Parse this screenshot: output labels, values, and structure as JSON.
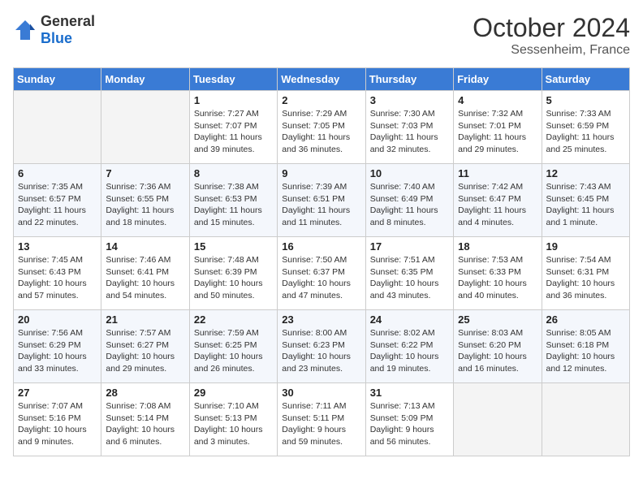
{
  "header": {
    "logo_general": "General",
    "logo_blue": "Blue",
    "month": "October 2024",
    "location": "Sessenheim, France"
  },
  "columns": [
    "Sunday",
    "Monday",
    "Tuesday",
    "Wednesday",
    "Thursday",
    "Friday",
    "Saturday"
  ],
  "weeks": [
    [
      {
        "day": "",
        "empty": true
      },
      {
        "day": "",
        "empty": true
      },
      {
        "day": "1",
        "sunrise": "Sunrise: 7:27 AM",
        "sunset": "Sunset: 7:07 PM",
        "daylight": "Daylight: 11 hours and 39 minutes."
      },
      {
        "day": "2",
        "sunrise": "Sunrise: 7:29 AM",
        "sunset": "Sunset: 7:05 PM",
        "daylight": "Daylight: 11 hours and 36 minutes."
      },
      {
        "day": "3",
        "sunrise": "Sunrise: 7:30 AM",
        "sunset": "Sunset: 7:03 PM",
        "daylight": "Daylight: 11 hours and 32 minutes."
      },
      {
        "day": "4",
        "sunrise": "Sunrise: 7:32 AM",
        "sunset": "Sunset: 7:01 PM",
        "daylight": "Daylight: 11 hours and 29 minutes."
      },
      {
        "day": "5",
        "sunrise": "Sunrise: 7:33 AM",
        "sunset": "Sunset: 6:59 PM",
        "daylight": "Daylight: 11 hours and 25 minutes."
      }
    ],
    [
      {
        "day": "6",
        "sunrise": "Sunrise: 7:35 AM",
        "sunset": "Sunset: 6:57 PM",
        "daylight": "Daylight: 11 hours and 22 minutes."
      },
      {
        "day": "7",
        "sunrise": "Sunrise: 7:36 AM",
        "sunset": "Sunset: 6:55 PM",
        "daylight": "Daylight: 11 hours and 18 minutes."
      },
      {
        "day": "8",
        "sunrise": "Sunrise: 7:38 AM",
        "sunset": "Sunset: 6:53 PM",
        "daylight": "Daylight: 11 hours and 15 minutes."
      },
      {
        "day": "9",
        "sunrise": "Sunrise: 7:39 AM",
        "sunset": "Sunset: 6:51 PM",
        "daylight": "Daylight: 11 hours and 11 minutes."
      },
      {
        "day": "10",
        "sunrise": "Sunrise: 7:40 AM",
        "sunset": "Sunset: 6:49 PM",
        "daylight": "Daylight: 11 hours and 8 minutes."
      },
      {
        "day": "11",
        "sunrise": "Sunrise: 7:42 AM",
        "sunset": "Sunset: 6:47 PM",
        "daylight": "Daylight: 11 hours and 4 minutes."
      },
      {
        "day": "12",
        "sunrise": "Sunrise: 7:43 AM",
        "sunset": "Sunset: 6:45 PM",
        "daylight": "Daylight: 11 hours and 1 minute."
      }
    ],
    [
      {
        "day": "13",
        "sunrise": "Sunrise: 7:45 AM",
        "sunset": "Sunset: 6:43 PM",
        "daylight": "Daylight: 10 hours and 57 minutes."
      },
      {
        "day": "14",
        "sunrise": "Sunrise: 7:46 AM",
        "sunset": "Sunset: 6:41 PM",
        "daylight": "Daylight: 10 hours and 54 minutes."
      },
      {
        "day": "15",
        "sunrise": "Sunrise: 7:48 AM",
        "sunset": "Sunset: 6:39 PM",
        "daylight": "Daylight: 10 hours and 50 minutes."
      },
      {
        "day": "16",
        "sunrise": "Sunrise: 7:50 AM",
        "sunset": "Sunset: 6:37 PM",
        "daylight": "Daylight: 10 hours and 47 minutes."
      },
      {
        "day": "17",
        "sunrise": "Sunrise: 7:51 AM",
        "sunset": "Sunset: 6:35 PM",
        "daylight": "Daylight: 10 hours and 43 minutes."
      },
      {
        "day": "18",
        "sunrise": "Sunrise: 7:53 AM",
        "sunset": "Sunset: 6:33 PM",
        "daylight": "Daylight: 10 hours and 40 minutes."
      },
      {
        "day": "19",
        "sunrise": "Sunrise: 7:54 AM",
        "sunset": "Sunset: 6:31 PM",
        "daylight": "Daylight: 10 hours and 36 minutes."
      }
    ],
    [
      {
        "day": "20",
        "sunrise": "Sunrise: 7:56 AM",
        "sunset": "Sunset: 6:29 PM",
        "daylight": "Daylight: 10 hours and 33 minutes."
      },
      {
        "day": "21",
        "sunrise": "Sunrise: 7:57 AM",
        "sunset": "Sunset: 6:27 PM",
        "daylight": "Daylight: 10 hours and 29 minutes."
      },
      {
        "day": "22",
        "sunrise": "Sunrise: 7:59 AM",
        "sunset": "Sunset: 6:25 PM",
        "daylight": "Daylight: 10 hours and 26 minutes."
      },
      {
        "day": "23",
        "sunrise": "Sunrise: 8:00 AM",
        "sunset": "Sunset: 6:23 PM",
        "daylight": "Daylight: 10 hours and 23 minutes."
      },
      {
        "day": "24",
        "sunrise": "Sunrise: 8:02 AM",
        "sunset": "Sunset: 6:22 PM",
        "daylight": "Daylight: 10 hours and 19 minutes."
      },
      {
        "day": "25",
        "sunrise": "Sunrise: 8:03 AM",
        "sunset": "Sunset: 6:20 PM",
        "daylight": "Daylight: 10 hours and 16 minutes."
      },
      {
        "day": "26",
        "sunrise": "Sunrise: 8:05 AM",
        "sunset": "Sunset: 6:18 PM",
        "daylight": "Daylight: 10 hours and 12 minutes."
      }
    ],
    [
      {
        "day": "27",
        "sunrise": "Sunrise: 7:07 AM",
        "sunset": "Sunset: 5:16 PM",
        "daylight": "Daylight: 10 hours and 9 minutes."
      },
      {
        "day": "28",
        "sunrise": "Sunrise: 7:08 AM",
        "sunset": "Sunset: 5:14 PM",
        "daylight": "Daylight: 10 hours and 6 minutes."
      },
      {
        "day": "29",
        "sunrise": "Sunrise: 7:10 AM",
        "sunset": "Sunset: 5:13 PM",
        "daylight": "Daylight: 10 hours and 3 minutes."
      },
      {
        "day": "30",
        "sunrise": "Sunrise: 7:11 AM",
        "sunset": "Sunset: 5:11 PM",
        "daylight": "Daylight: 9 hours and 59 minutes."
      },
      {
        "day": "31",
        "sunrise": "Sunrise: 7:13 AM",
        "sunset": "Sunset: 5:09 PM",
        "daylight": "Daylight: 9 hours and 56 minutes."
      },
      {
        "day": "",
        "empty": true
      },
      {
        "day": "",
        "empty": true
      }
    ]
  ]
}
